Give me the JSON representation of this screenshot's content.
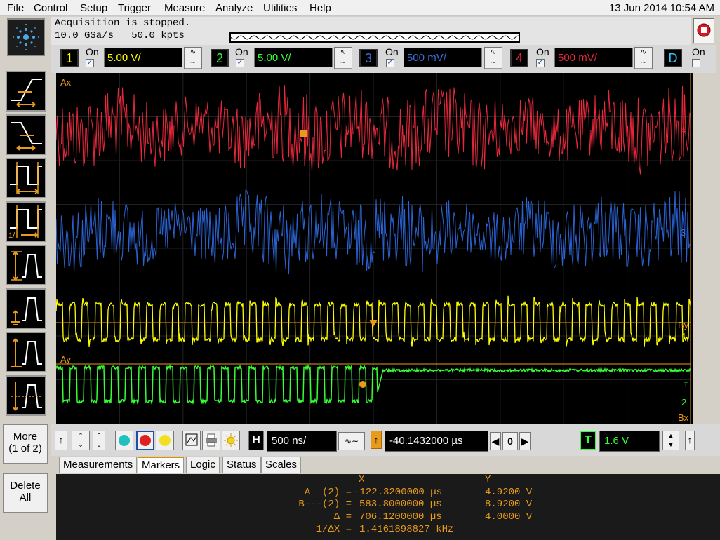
{
  "menu": [
    "File",
    "Control",
    "Setup",
    "Trigger",
    "Measure",
    "Analyze",
    "Utilities",
    "Help"
  ],
  "datetime": "13 Jun 2014 10:54 AM",
  "acquisition": {
    "status": "Acquisition is stopped.",
    "rate": "10.0 GSa/s",
    "points": "50.0 kpts"
  },
  "channels": [
    {
      "num": "1",
      "on_label": "On",
      "on": true,
      "scale": "5.00 V/",
      "color": "#ffff00"
    },
    {
      "num": "2",
      "on_label": "On",
      "on": true,
      "scale": "5.00 V/",
      "color": "#33ff33"
    },
    {
      "num": "3",
      "on_label": "On",
      "on": true,
      "scale": "500 mV/",
      "color": "#3a6fd8"
    },
    {
      "num": "4",
      "on_label": "On",
      "on": true,
      "scale": "500 mV/",
      "color": "#e8283c"
    }
  ],
  "digital": {
    "label": "D",
    "on_label": "On",
    "on": false
  },
  "screen_labels": {
    "ax": "Ax",
    "ay": "Ay",
    "bx": "Bx",
    "by": "By",
    "ch4": "4",
    "ch3": "3",
    "ch1": "1",
    "ch2": "2",
    "trig": "T"
  },
  "left_buttons": {
    "more": "More (1 of 2)",
    "more_l1": "More",
    "more_l2": "(1 of 2)",
    "delete_l1": "Delete",
    "delete_l2": "All"
  },
  "timebase": {
    "h_label": "H",
    "scale": "500 ns/",
    "delay": "-40.1432000 µs",
    "zero": "0"
  },
  "trigger": {
    "label": "T",
    "level": "1.6 V"
  },
  "tabs": [
    "Measurements",
    "Markers",
    "Logic",
    "Status",
    "Scales"
  ],
  "active_tab": "Markers",
  "markers": {
    "header_x": "X",
    "header_y": "Y",
    "rows": [
      {
        "label": "A——(2) =",
        "x": "-122.3200000 µs",
        "y": "4.9200 V"
      },
      {
        "label": "B---(2) =",
        "x": "583.8000000 µs",
        "y": "8.9200 V"
      },
      {
        "label": "Δ =",
        "x": "706.1200000 µs",
        "y": "4.0000 V"
      },
      {
        "label": "1/ΔX =",
        "x": "1.4161898827 kHz",
        "y": ""
      }
    ]
  },
  "colors": {
    "ch1": "#ffff00",
    "ch2": "#33ff33",
    "ch3": "#2a62d0",
    "ch4": "#e8283c",
    "marker": "#e89a1a"
  }
}
